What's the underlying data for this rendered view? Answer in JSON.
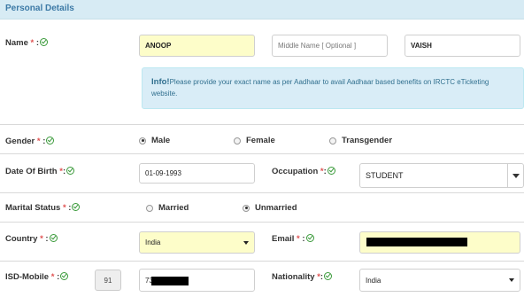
{
  "section": {
    "title": "Personal Details"
  },
  "name": {
    "label": "Name",
    "required": "*",
    "colon": ":",
    "first": "ANOOP",
    "middle_placeholder": "Middle Name  [ Optional ]",
    "last": "VAISH",
    "info_title": "Info!",
    "info_text": "Please provide your exact name as per Aadhaar to avail Aadhaar based benefits on IRCTC eTicketing website."
  },
  "gender": {
    "label": "Gender",
    "required": "*",
    "colon": ":",
    "options": [
      "Male",
      "Female",
      "Transgender"
    ],
    "selected": "Male"
  },
  "dob": {
    "label": "Date Of Birth",
    "required": "*",
    "colon": ":",
    "value": "01-09-1993"
  },
  "occupation": {
    "label": "Occupation",
    "required": "*",
    "colon": ":",
    "value": "STUDENT"
  },
  "marital": {
    "label": "Marital Status",
    "required": "*",
    "colon": ":",
    "options": [
      "Married",
      "Unmarried"
    ],
    "selected": "Unmarried"
  },
  "country": {
    "label": "Country",
    "required": "*",
    "colon": ":",
    "value": "India"
  },
  "email": {
    "label": "Email",
    "required": "*",
    "colon": ":",
    "value": ""
  },
  "mobile": {
    "label": "ISD-Mobile",
    "required": "*",
    "colon": ":",
    "isd": "91",
    "value_prefix": "73"
  },
  "nationality": {
    "label": "Nationality",
    "required": "*",
    "colon": ":",
    "value": "India"
  },
  "colors": {
    "header_bg": "#d7ebf4",
    "header_text": "#3d7aa6",
    "required": "#e05252",
    "check": "#3a9a3a",
    "highlight": "#fdfdc9",
    "info_bg": "#d9edf7",
    "info_text": "#31708f"
  },
  "icons": {
    "valid": "check-circle-icon",
    "dropdown": "caret-down-icon"
  }
}
